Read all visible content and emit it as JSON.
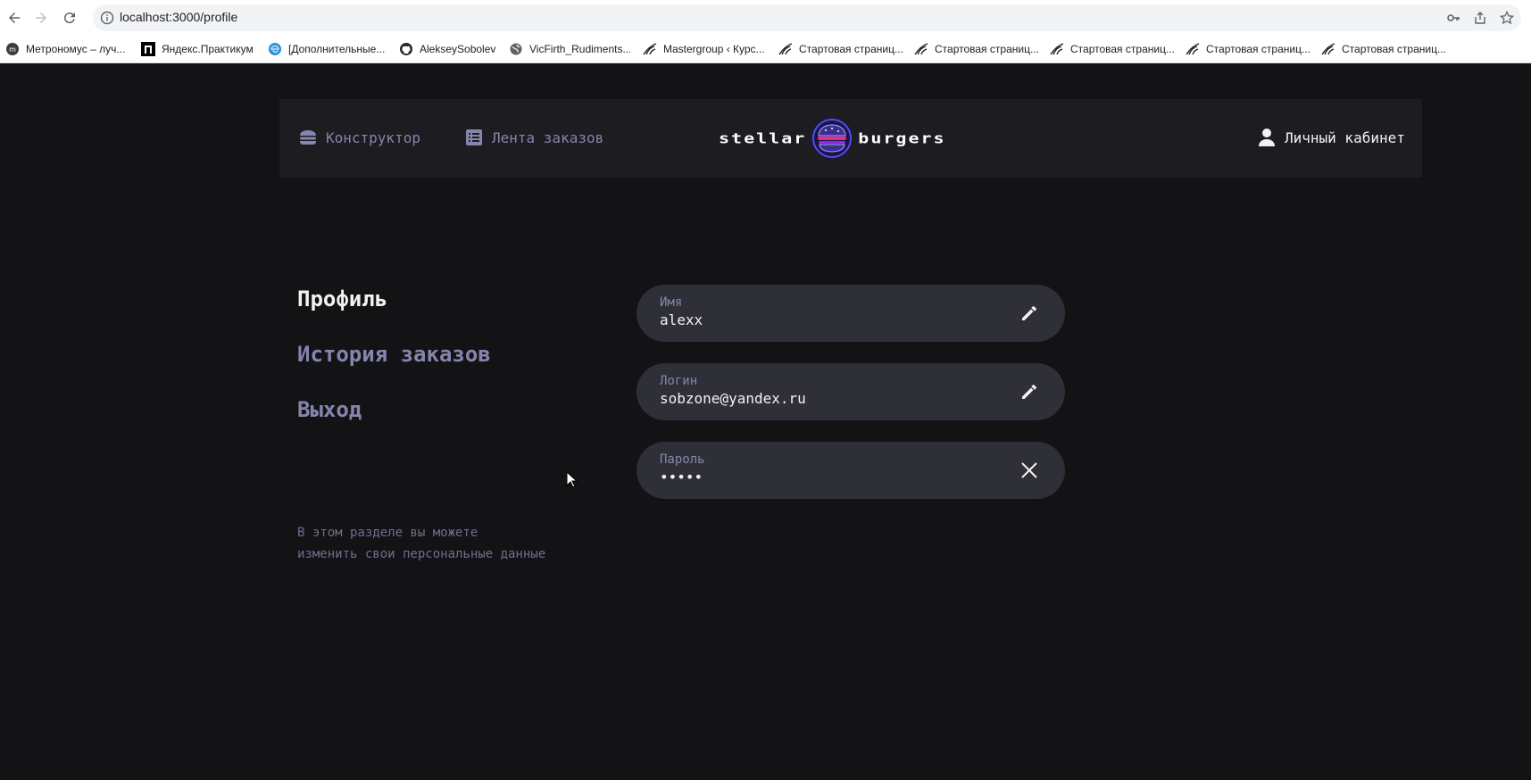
{
  "browser": {
    "url": "localhost:3000/profile",
    "bookmarks": [
      {
        "label": "Метрономус – луч...",
        "icon": "metronome-favicon"
      },
      {
        "label": "Яндекс.Практикум",
        "icon": "practicum-favicon"
      },
      {
        "label": "[Дополнительные...",
        "icon": "edge-favicon"
      },
      {
        "label": "AlekseySobolev",
        "icon": "github-favicon"
      },
      {
        "label": "VicFirth_Rudiments...",
        "icon": "globe-favicon"
      },
      {
        "label": "Mastergroup ‹ Курс...",
        "icon": "mastergroup-favicon"
      },
      {
        "label": "Стартовая страниц...",
        "icon": "mastergroup-favicon"
      },
      {
        "label": "Стартовая страниц...",
        "icon": "mastergroup-favicon"
      },
      {
        "label": "Стартовая страниц...",
        "icon": "mastergroup-favicon"
      },
      {
        "label": "Стартовая страниц...",
        "icon": "mastergroup-favicon"
      },
      {
        "label": "Стартовая страниц...",
        "icon": "mastergroup-favicon"
      }
    ]
  },
  "header": {
    "constructor_label": "Конструктор",
    "feed_label": "Лента заказов",
    "logo_left": "stellar",
    "logo_right": "burgers",
    "account_label": "Личный кабинет"
  },
  "profile_nav": {
    "items": [
      {
        "label": "Профиль",
        "active": true
      },
      {
        "label": "История заказов",
        "active": false
      },
      {
        "label": "Выход",
        "active": false
      }
    ],
    "caption_line1": "В этом разделе вы можете",
    "caption_line2": "изменить свои персональные данные"
  },
  "form": {
    "name": {
      "label": "Имя",
      "value": "alexx",
      "icon": "edit-pencil-icon"
    },
    "login": {
      "label": "Логин",
      "value": "sobzone@yandex.ru",
      "icon": "edit-pencil-icon"
    },
    "password": {
      "label": "Пароль",
      "value": "•••••",
      "icon": "close-icon"
    }
  },
  "colors": {
    "background": "#131316",
    "header_bg": "#1c1c21",
    "field_bg": "#2f2f37",
    "inactive_text": "#8585ad",
    "active_text": "#f2f2f3"
  }
}
